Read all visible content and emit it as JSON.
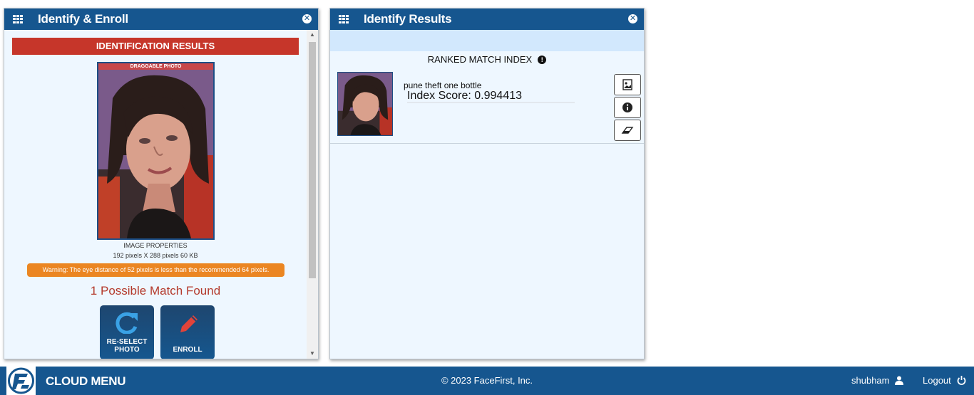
{
  "left_panel": {
    "title": "Identify & Enroll",
    "results_header": "IDENTIFICATION RESULTS",
    "drag_label": "DRAGGABLE PHOTO",
    "image_properties_label": "IMAGE PROPERTIES",
    "image_size": "192 pixels X 288 pixels 60 KB",
    "warning": "Warning: The eye distance of 52 pixels is less than the recommended 64 pixels.",
    "match_found": "1 Possible Match Found",
    "reselect_label_1": "RE-SELECT",
    "reselect_label_2": "PHOTO",
    "enroll_label": "ENROLL"
  },
  "right_panel": {
    "title": "Identify Results",
    "ranked_title": "RANKED MATCH INDEX",
    "matches": [
      {
        "name": "pune theft one bottle",
        "score": "Index Score: 0.994413"
      }
    ]
  },
  "footer": {
    "menu": "CLOUD MENU",
    "copyright": "© 2023 FaceFirst, Inc.",
    "user": "shubham",
    "logout": "Logout"
  },
  "colors": {
    "header_blue": "#16568f",
    "alert_red": "#c6362a",
    "warning_orange": "#eb8622",
    "panel_bg": "#eef7ff"
  }
}
